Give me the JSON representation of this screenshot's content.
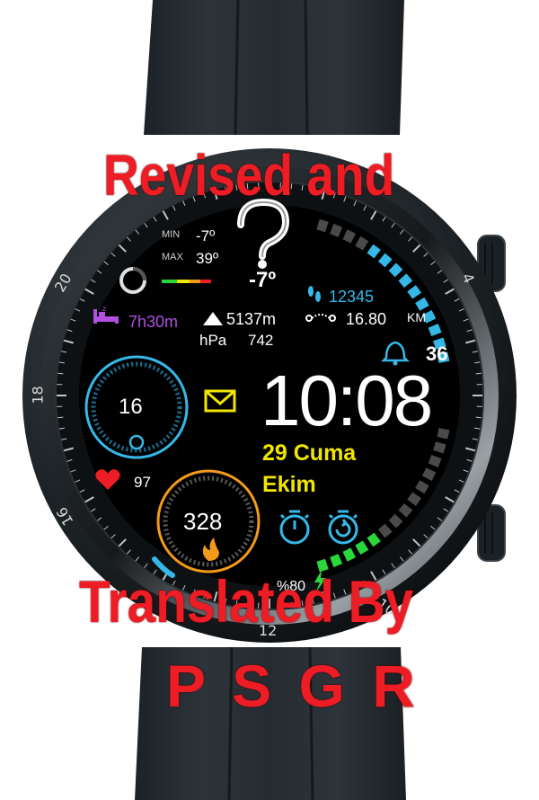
{
  "watermark": {
    "line1": "Revised and",
    "line2": "Translated By",
    "line3": "P S G R"
  },
  "bezel": {
    "n20": "20",
    "n18": "18",
    "n16": "16",
    "n12": "12",
    "n10": "10",
    "n4": "4"
  },
  "weather": {
    "min_label": "MIN",
    "min_value": "-7º",
    "max_label": "MAX",
    "max_value": "39º",
    "current": "-7º",
    "icon": "question-mark-icon"
  },
  "steps": {
    "value": "12345",
    "icon": "footprints-icon"
  },
  "distance": {
    "value": "16.80",
    "unit": "KM",
    "icon": "route-icon"
  },
  "sleep": {
    "value": "7h30m",
    "icon": "bed-icon"
  },
  "altitude": {
    "value": "5137m",
    "icon": "mountain-icon"
  },
  "pressure": {
    "label": "hPa",
    "value": "742"
  },
  "alarm": {
    "value": "36",
    "icon": "bell-icon"
  },
  "battery_ring": {
    "value": "16"
  },
  "message": {
    "icon": "envelope-icon"
  },
  "time": {
    "value": "10:08"
  },
  "date": {
    "day_name": "29 Cuma",
    "month": "Ekim"
  },
  "heart": {
    "value": "97",
    "icon": "heart-icon"
  },
  "calories": {
    "value": "328",
    "icon": "flame-icon"
  },
  "timers": {
    "stopwatch_icon": "stopwatch-icon",
    "timer_icon": "timer-reset-icon"
  },
  "battery": {
    "value": "%80",
    "icon": "bolt-icon"
  },
  "colors": {
    "cyan": "#35b8e8",
    "yellow": "#f2e600",
    "red": "#ee1c24",
    "green": "#2ad63a",
    "orange": "#f39a1a",
    "purple": "#b04fe0"
  }
}
